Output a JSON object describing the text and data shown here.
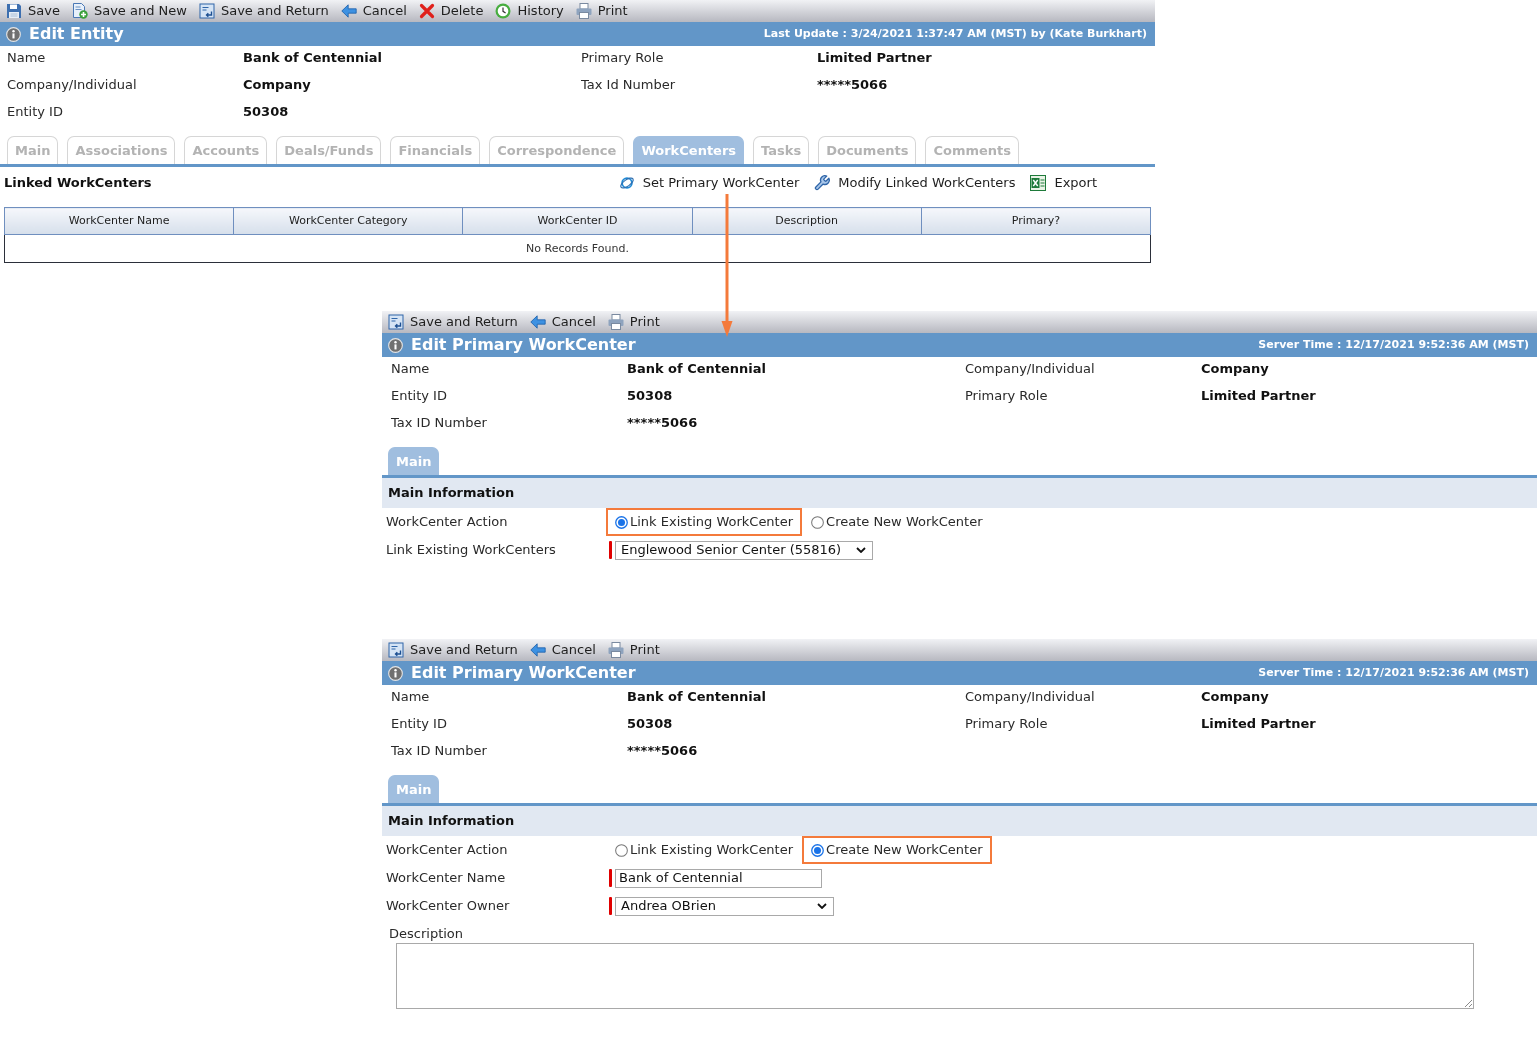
{
  "entity_editor": {
    "toolbar": [
      {
        "kind": "save",
        "label": "Save"
      },
      {
        "kind": "save_new",
        "label": "Save and New"
      },
      {
        "kind": "save_return",
        "label": "Save and Return"
      },
      {
        "kind": "cancel",
        "label": "Cancel"
      },
      {
        "kind": "delete",
        "label": "Delete"
      },
      {
        "kind": "history",
        "label": "History"
      },
      {
        "kind": "print",
        "label": "Print"
      }
    ],
    "title": "Edit Entity",
    "header_note": "Last Update : 3/24/2021 1:37:47 AM (MST) by (Kate Burkhart)",
    "fields": [
      {
        "label": "Name",
        "value": "Bank of Centennial"
      },
      {
        "label": "Primary Role",
        "value": "Limited Partner"
      },
      {
        "label": "Company/Individual",
        "value": "Company"
      },
      {
        "label": "Tax Id Number",
        "value": "*****5066"
      },
      {
        "label": "Entity ID",
        "value": "50308"
      }
    ],
    "tabs": [
      {
        "label": "Main",
        "selected": false
      },
      {
        "label": "Associations",
        "selected": false
      },
      {
        "label": "Accounts",
        "selected": false
      },
      {
        "label": "Deals/Funds",
        "selected": false
      },
      {
        "label": "Financials",
        "selected": false
      },
      {
        "label": "Correspondence",
        "selected": false
      },
      {
        "label": "WorkCenters",
        "selected": true
      },
      {
        "label": "Tasks",
        "selected": false
      },
      {
        "label": "Documents",
        "selected": false
      },
      {
        "label": "Comments",
        "selected": false
      }
    ],
    "section_title": "Linked WorkCenters",
    "actions": [
      {
        "kind": "set_primary",
        "label": "Set Primary WorkCenter"
      },
      {
        "kind": "modify",
        "label": "Modify Linked WorkCenters"
      },
      {
        "kind": "export",
        "label": "Export"
      }
    ],
    "table": {
      "columns": [
        "WorkCenter Name",
        "WorkCenter Category",
        "WorkCenter ID",
        "Description",
        "Primary?"
      ],
      "empty_message": "No Records Found."
    }
  },
  "workcenter_editors": [
    {
      "toolbar": [
        {
          "kind": "save_return",
          "label": "Save and Return"
        },
        {
          "kind": "cancel",
          "label": "Cancel"
        },
        {
          "kind": "print",
          "label": "Print"
        }
      ],
      "title": "Edit Primary WorkCenter",
      "header_note": "Server Time : 12/17/2021 9:52:36 AM (MST)",
      "fields": [
        {
          "label": "Name",
          "value": "Bank of Centennial"
        },
        {
          "label": "Company/Individual",
          "value": "Company"
        },
        {
          "label": "Entity ID",
          "value": "50308"
        },
        {
          "label": "Primary Role",
          "value": "Limited Partner"
        },
        {
          "label": "Tax ID Number",
          "value": "*****5066"
        }
      ],
      "tabs": [
        {
          "label": "Main",
          "selected": true
        }
      ],
      "section_title": "Main Information",
      "form": [
        {
          "kind": "radio",
          "label": "WorkCenter Action",
          "options": [
            {
              "label": "Link Existing WorkCenter",
              "selected": true,
              "highlighted": true
            },
            {
              "label": "Create New WorkCenter",
              "selected": false,
              "highlighted": false
            }
          ]
        },
        {
          "kind": "select",
          "label": "Link Existing WorkCenters",
          "value": "Englewood Senior Center (55816)",
          "required": true
        }
      ]
    },
    {
      "toolbar": [
        {
          "kind": "save_return",
          "label": "Save and Return"
        },
        {
          "kind": "cancel",
          "label": "Cancel"
        },
        {
          "kind": "print",
          "label": "Print"
        }
      ],
      "title": "Edit Primary WorkCenter",
      "header_note": "Server Time : 12/17/2021 9:52:36 AM (MST)",
      "fields": [
        {
          "label": "Name",
          "value": "Bank of Centennial"
        },
        {
          "label": "Company/Individual",
          "value": "Company"
        },
        {
          "label": "Entity ID",
          "value": "50308"
        },
        {
          "label": "Primary Role",
          "value": "Limited Partner"
        },
        {
          "label": "Tax ID Number",
          "value": "*****5066"
        }
      ],
      "tabs": [
        {
          "label": "Main",
          "selected": true
        }
      ],
      "section_title": "Main Information",
      "form": [
        {
          "kind": "radio",
          "label": "WorkCenter Action",
          "options": [
            {
              "label": "Link Existing WorkCenter",
              "selected": false,
              "highlighted": false
            },
            {
              "label": "Create New WorkCenter",
              "selected": true,
              "highlighted": true
            }
          ]
        },
        {
          "kind": "text",
          "label": "WorkCenter Name",
          "value": "Bank of Centennial",
          "required": true
        },
        {
          "kind": "select",
          "label": "WorkCenter Owner",
          "value": "Andrea OBrien",
          "required": true
        },
        {
          "kind": "textarea",
          "label": "Description"
        }
      ]
    }
  ]
}
